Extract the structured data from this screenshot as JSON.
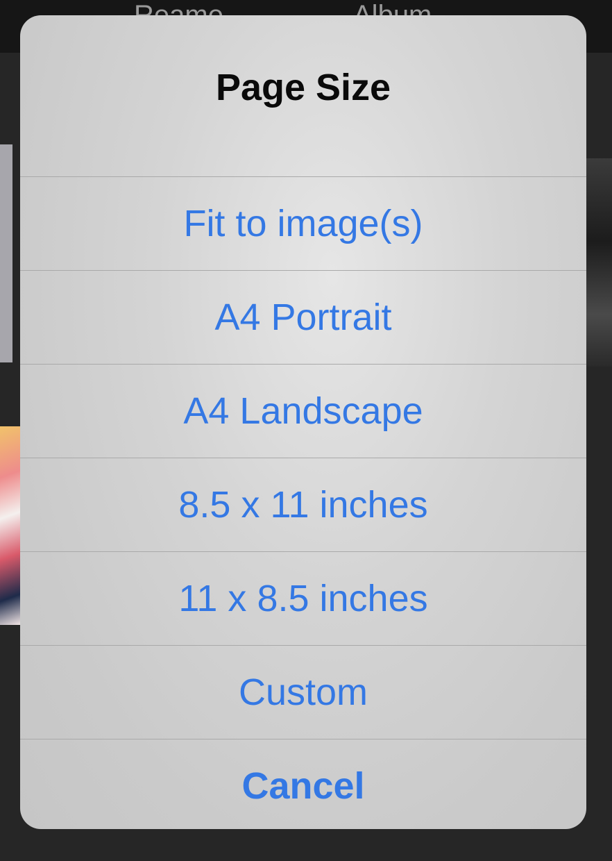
{
  "background": {
    "tabs": [
      "Reame",
      "Album"
    ]
  },
  "sheet": {
    "title": "Page Size",
    "options": [
      "Fit to image(s)",
      "A4 Portrait",
      "A4 Landscape",
      "8.5 x 11 inches",
      "11 x 8.5 inches",
      "Custom"
    ],
    "cancel_label": "Cancel"
  },
  "colors": {
    "accent": "#3478e4",
    "title": "#0a0a0a",
    "sheet_background": "#d4d4d4",
    "app_background": "#232323"
  }
}
